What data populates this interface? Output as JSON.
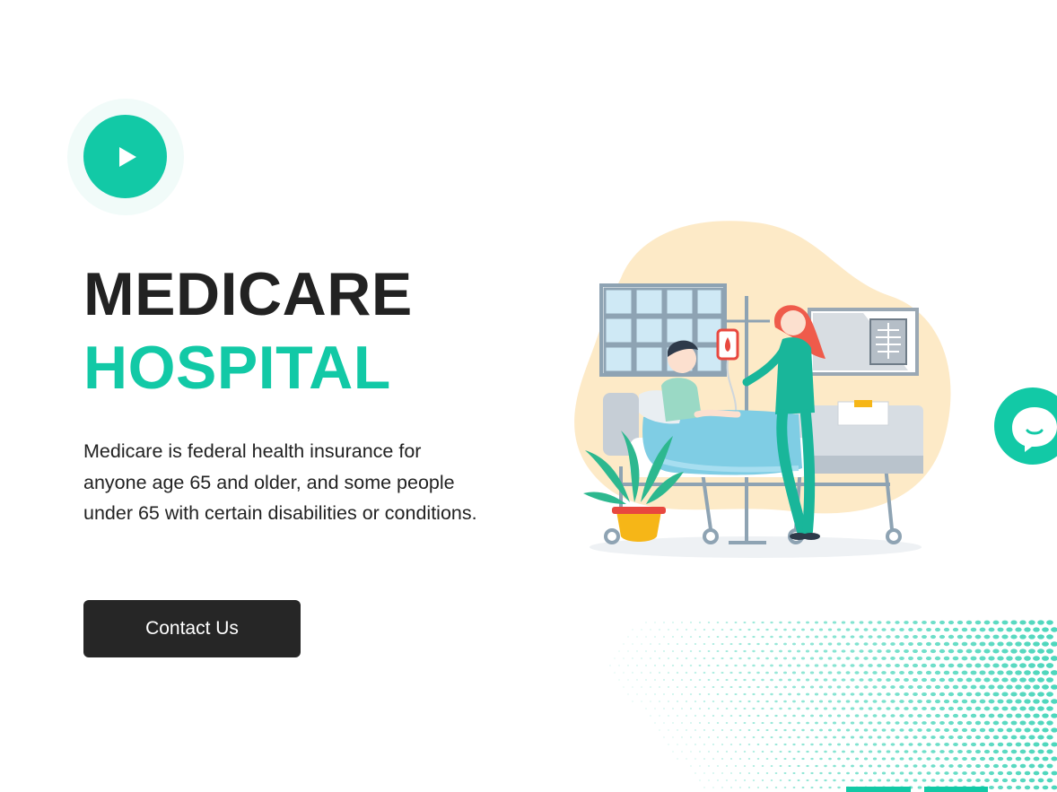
{
  "hero": {
    "title_line1": "MEDICARE",
    "title_line2": "HOSPITAL",
    "description": "Medicare is federal health insurance for anyone age 65 and older, and some people under 65 with certain disabilities or conditions.",
    "contact_label": "Contact Us"
  },
  "icons": {
    "play": "play-icon",
    "chat": "chat-icon",
    "illustration": "hospital-bed-illustration"
  },
  "colors": {
    "accent": "#12c9a6",
    "dark": "#222222",
    "button_dark": "#262626"
  }
}
